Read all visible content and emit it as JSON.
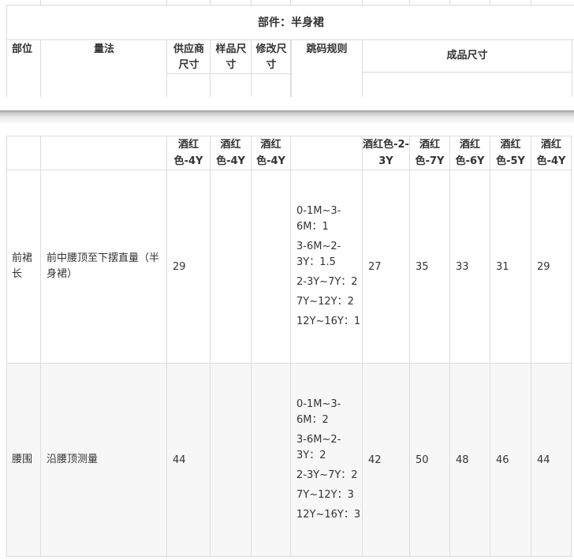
{
  "section": {
    "title": "部件：半身裙"
  },
  "headers": {
    "part": "部位",
    "method": "量法",
    "supplier_size": "供应商尺寸",
    "sample_size": "样品尺寸",
    "revised_size": "修改尺寸",
    "grading_rule": "跳码规则",
    "finished_size": "成品尺寸"
  },
  "sub_headers": {
    "supplier": "酒红色-4Y",
    "sample": "酒红色-4Y",
    "revised": "酒红色-4Y",
    "finished": [
      "酒红色-2-3Y",
      "酒红色-7Y",
      "酒红色-6Y",
      "酒红色-5Y",
      "酒红色-4Y"
    ]
  },
  "rows": [
    {
      "part": "前裙长",
      "method": "前中腰顶至下摆直量（半身裙）",
      "supplier": "29",
      "sample": "",
      "revised": "",
      "rules": [
        "0-1M~3-6M：1",
        "3-6M~2-3Y：1.5",
        "2-3Y~7Y：2",
        "7Y~12Y：2",
        "12Y~16Y：1"
      ],
      "finished": [
        "27",
        "35",
        "33",
        "31",
        "29"
      ]
    },
    {
      "part": "腰围",
      "method": "沿腰顶测量",
      "supplier": "44",
      "sample": "",
      "revised": "",
      "rules": [
        "0-1M~3-6M：2",
        "3-6M~2-3Y：2",
        "2-3Y~7Y：2",
        "7Y~12Y：3",
        "12Y~16Y：3"
      ],
      "finished": [
        "42",
        "50",
        "48",
        "46",
        "44"
      ]
    }
  ]
}
